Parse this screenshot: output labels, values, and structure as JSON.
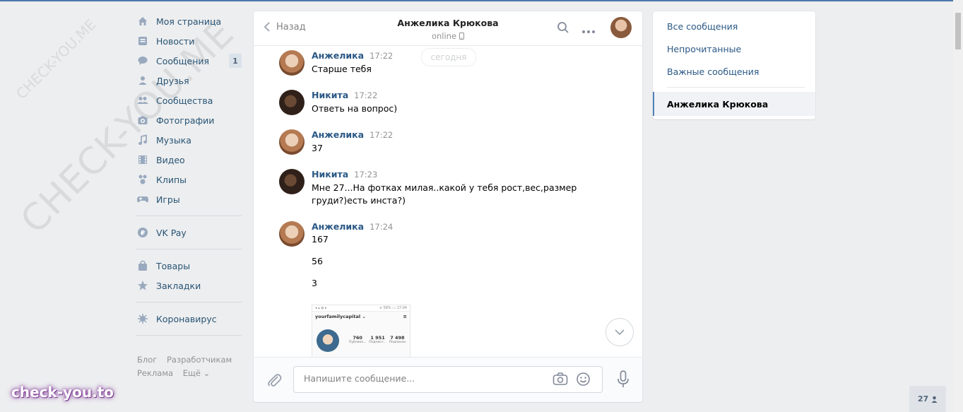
{
  "nav": {
    "items": [
      {
        "label": "Моя страница",
        "icon": "home-icon"
      },
      {
        "label": "Новости",
        "icon": "news-icon"
      },
      {
        "label": "Сообщения",
        "icon": "messages-icon",
        "count": "1"
      },
      {
        "label": "Друзья",
        "icon": "friends-icon"
      },
      {
        "label": "Сообщества",
        "icon": "groups-icon"
      },
      {
        "label": "Фотографии",
        "icon": "camera-icon"
      },
      {
        "label": "Музыка",
        "icon": "music-icon"
      },
      {
        "label": "Видео",
        "icon": "video-icon"
      },
      {
        "label": "Клипы",
        "icon": "clips-icon"
      },
      {
        "label": "Игры",
        "icon": "games-icon"
      },
      {
        "label": "VK Pay",
        "icon": "vkpay-icon"
      },
      {
        "label": "Товары",
        "icon": "bag-icon"
      },
      {
        "label": "Закладки",
        "icon": "star-icon"
      },
      {
        "label": "Коронавирус",
        "icon": "virus-icon"
      }
    ],
    "footer": [
      "Блог",
      "Разработчикам",
      "Реклама",
      "Ещё ⌄"
    ]
  },
  "watermark": {
    "small": "CHECK-YOU.ME",
    "large": "CHECK-YOU.ME",
    "badge": "check-you.to"
  },
  "chat": {
    "back_label": "Назад",
    "peer_name": "Анжелика Крюкова",
    "peer_status": "online",
    "date_label": "сегодня",
    "messages": [
      {
        "author": "Анжелика",
        "time": "17:22",
        "text": "Старше тебя"
      },
      {
        "author": "Никита",
        "time": "17:22",
        "text": "Ответь на вопрос)"
      },
      {
        "author": "Анжелика",
        "time": "17:22",
        "text": "37"
      },
      {
        "author": "Никита",
        "time": "17:23",
        "text": "Мне 27...На фотках милая..какой у тебя рост,вес,размер\nгруди?)есть инста?)"
      },
      {
        "author": "Анжелика",
        "time": "17:24",
        "text": "167\n\n56\n\n3"
      }
    ],
    "attachment": {
      "status_left": "◂ ▴ ◍ ▸",
      "status_right": "∗ 58% ▭ 17:04",
      "username": "yourfamilycapital ⌄",
      "stats": [
        {
          "value": "760",
          "label": "Публика..."
        },
        {
          "value": "1 951",
          "label": "Подписч..."
        },
        {
          "value": "7 498",
          "label": "Подписки"
        }
      ]
    },
    "composer_placeholder": "Напишите сообщение..."
  },
  "side": {
    "items": [
      "Все сообщения",
      "Непрочитанные",
      "Важные сообщения"
    ],
    "active": "Анжелика Крюкова"
  },
  "online_count": "27",
  "colors": {
    "accent": "#4a76a8",
    "link": "#2a5885",
    "nav_text": "#285473",
    "background": "#edeef0"
  }
}
